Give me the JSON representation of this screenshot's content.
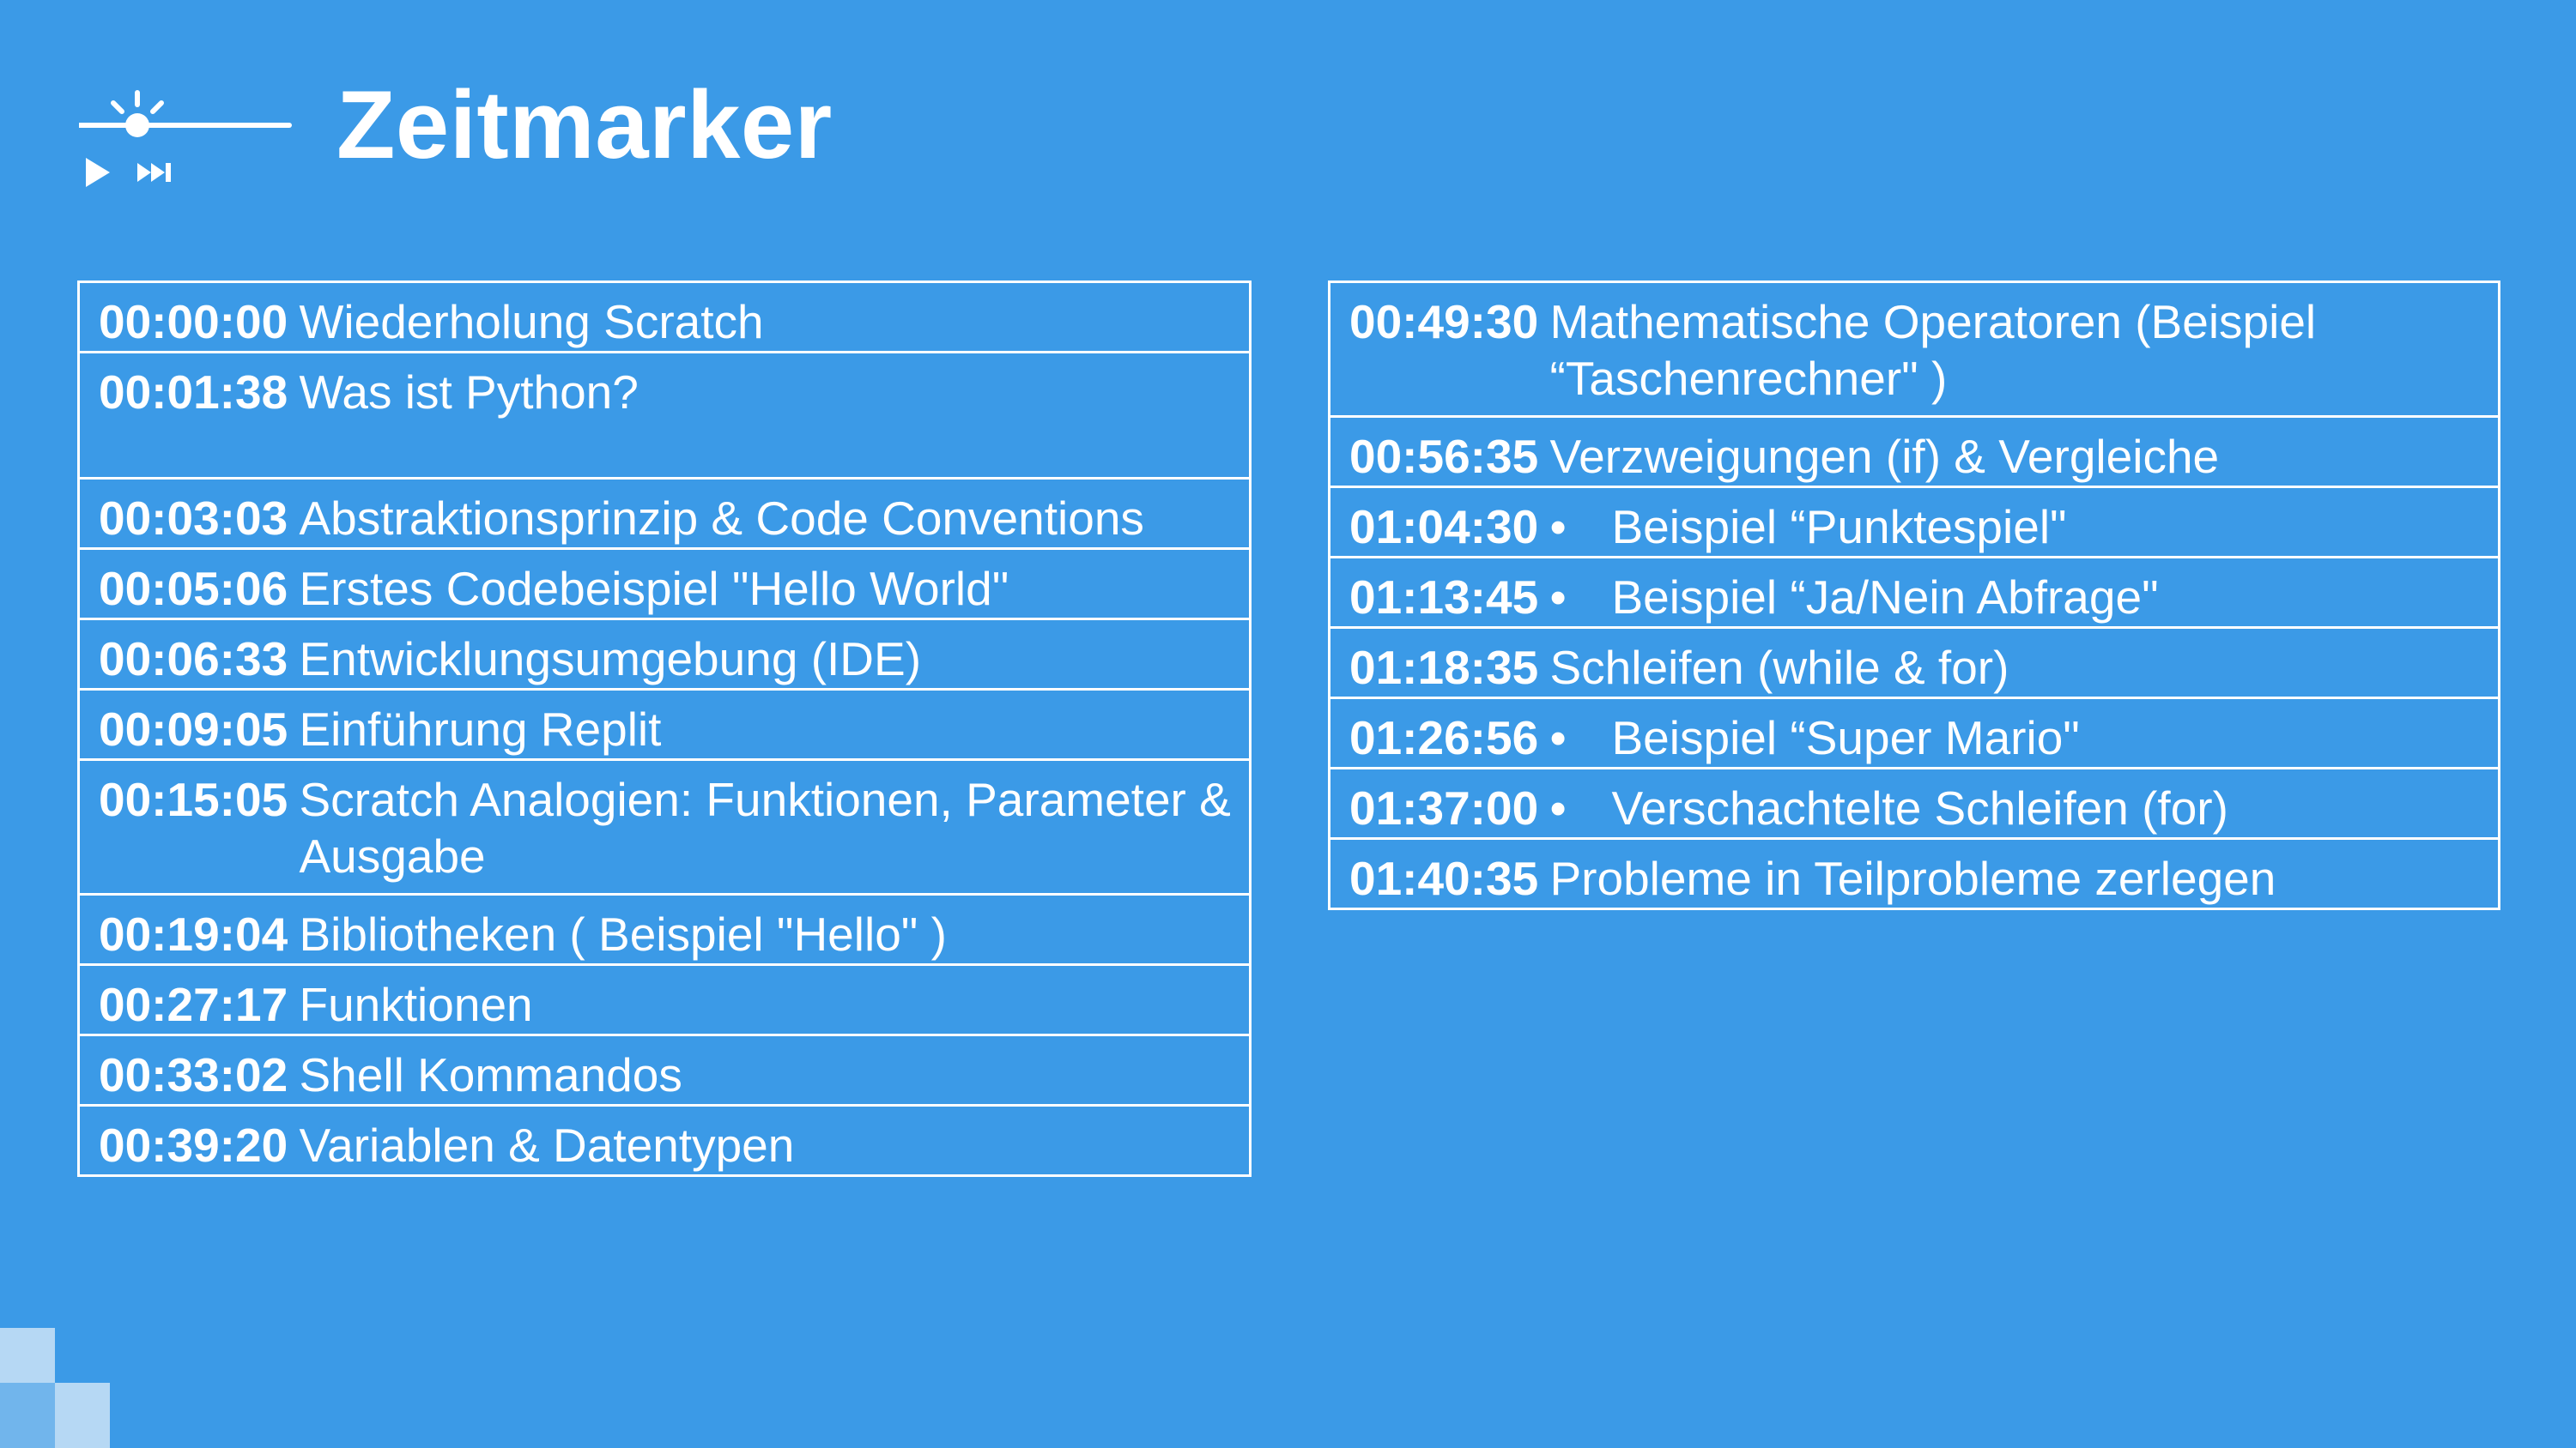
{
  "slide": {
    "title": "Zeitmarker",
    "header_icon": "timeline-play-icon",
    "colors": {
      "background": "#3b9ae7",
      "text": "#ffffff",
      "border": "#ffffff"
    }
  },
  "left_table": {
    "rows": [
      {
        "time": "00:00:00",
        "label": "Wiederholung Scratch"
      },
      {
        "time": "00:01:38",
        "label": "Was ist Python?"
      },
      {
        "time": "00:03:03",
        "label": "Abstraktionsprinzip & Code Conventions"
      },
      {
        "time": "00:05:06",
        "label": "Erstes Codebeispiel \"Hello World\""
      },
      {
        "time": "00:06:33",
        "label": "Entwicklungsumgebung (IDE)"
      },
      {
        "time": "00:09:05",
        "label": "Einführung Replit"
      },
      {
        "time": "00:15:05",
        "label": "Scratch Analogien: Funktionen, Parameter & Ausgabe"
      },
      {
        "time": "00:19:04",
        "label": "Bibliotheken ( Beispiel \"Hello\" )"
      },
      {
        "time": "00:27:17",
        "label": "Funktionen"
      },
      {
        "time": "00:33:02",
        "label": "Shell Kommandos"
      },
      {
        "time": "00:39:20",
        "label": "Variablen & Datentypen"
      }
    ]
  },
  "right_table": {
    "rows": [
      {
        "time": "00:49:30",
        "label": "Mathematische Operatoren (Beispiel “Taschenrechner\" )"
      },
      {
        "time": "00:56:35",
        "label": "Verzweigungen (if) & Vergleiche"
      },
      {
        "time": "01:04:30",
        "bullet": "•",
        "label": "Beispiel “Punktespiel\""
      },
      {
        "time": "01:13:45",
        "bullet": "•",
        "label": "Beispiel “Ja/Nein Abfrage\""
      },
      {
        "time": "01:18:35",
        "label": "Schleifen (while & for)"
      },
      {
        "time": "01:26:56",
        "bullet": "•",
        "label": "Beispiel “Super Mario\""
      },
      {
        "time": "01:37:00",
        "bullet": "•",
        "label": "Verschachtelte Schleifen (for)"
      },
      {
        "time": "01:40:35",
        "label": "Probleme in Teilprobleme zerlegen"
      }
    ]
  }
}
